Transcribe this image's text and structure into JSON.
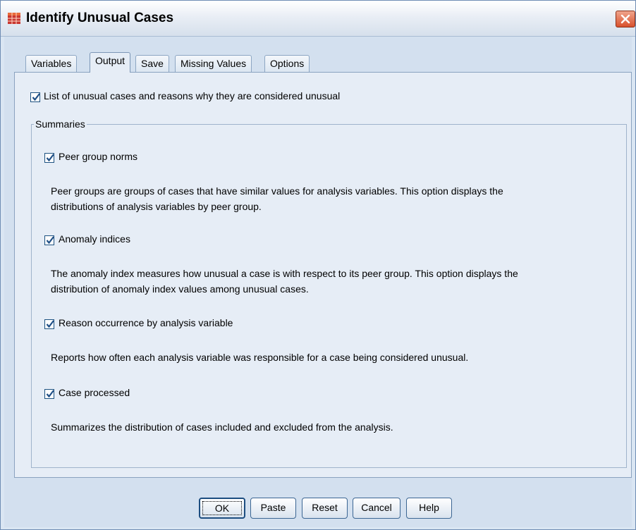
{
  "window": {
    "title": "Identify Unusual Cases"
  },
  "icons": {
    "app": "spss-grid-icon",
    "close": "close-icon",
    "check": "checkmark-icon"
  },
  "tabs": [
    {
      "label": "Variables",
      "active": false
    },
    {
      "label": "Output",
      "active": true
    },
    {
      "label": "Save",
      "active": false
    },
    {
      "label": "Missing Values",
      "active": false
    },
    {
      "label": "Options",
      "active": false
    }
  ],
  "output": {
    "list_unusual": {
      "label": "List of unusual cases and reasons why they are considered unusual",
      "checked": true
    },
    "summaries": {
      "legend": "Summaries",
      "peer_group_norms": {
        "label": "Peer group norms",
        "checked": true,
        "desc1": "Peer groups are groups of cases that have similar values for analysis variables. This option displays the",
        "desc2": "distributions of analysis variables by peer group."
      },
      "anomaly_indices": {
        "label": "Anomaly indices",
        "checked": true,
        "desc1": "The anomaly index measures how unusual a case is with respect to its peer group. This option displays the",
        "desc2": "distribution of anomaly index values among unusual cases."
      },
      "reason_occurrence": {
        "label": "Reason occurrence by analysis variable",
        "checked": true,
        "desc1": "Reports how often each analysis variable was responsible for a case being considered unusual."
      },
      "case_processed": {
        "label": "Case processed",
        "checked": true,
        "desc1": "Summarizes the distribution of cases included and excluded from the analysis."
      }
    }
  },
  "buttons": {
    "ok": "OK",
    "paste": "Paste",
    "reset": "Reset",
    "cancel": "Cancel",
    "help": "Help"
  },
  "colors": {
    "panel": "#e6edf6",
    "border": "#8aa2bf",
    "checkbox_border": "#1c5180",
    "check_mark": "#1f4f86",
    "close_red": "#d8512d"
  }
}
